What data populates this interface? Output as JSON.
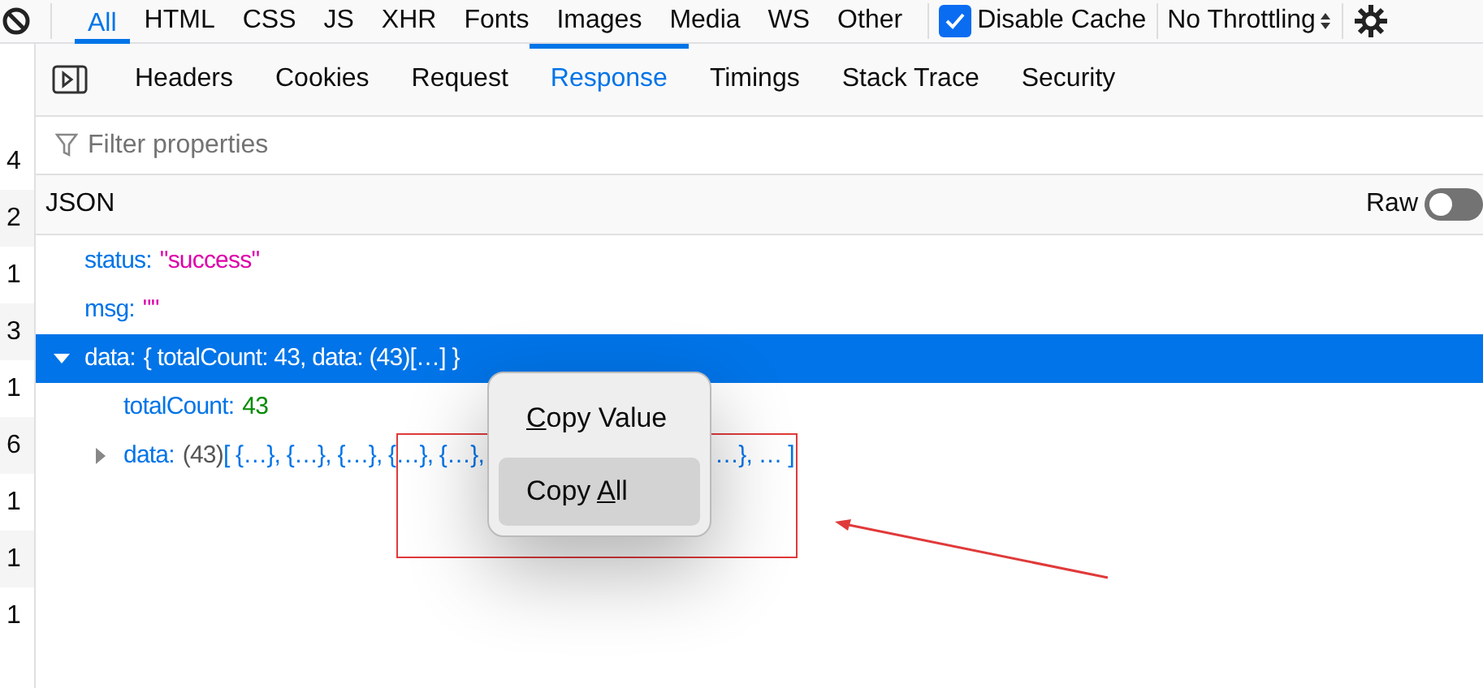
{
  "toolbar": {
    "filters": [
      {
        "label": "All",
        "selected": true
      },
      {
        "label": "HTML",
        "selected": false
      },
      {
        "label": "CSS",
        "selected": false
      },
      {
        "label": "JS",
        "selected": false
      },
      {
        "label": "XHR",
        "selected": false
      },
      {
        "label": "Fonts",
        "selected": false
      },
      {
        "label": "Images",
        "selected": false
      },
      {
        "label": "Media",
        "selected": false
      },
      {
        "label": "WS",
        "selected": false
      },
      {
        "label": "Other",
        "selected": false
      }
    ],
    "disable_cache": {
      "label": "Disable Cache",
      "checked": true
    },
    "throttling": "No Throttling"
  },
  "gutter": [
    "4",
    "2",
    "1",
    "3",
    "1",
    "6",
    "1",
    "1",
    "1"
  ],
  "tabs": [
    {
      "label": "Headers",
      "selected": false
    },
    {
      "label": "Cookies",
      "selected": false
    },
    {
      "label": "Request",
      "selected": false
    },
    {
      "label": "Response",
      "selected": true
    },
    {
      "label": "Timings",
      "selected": false
    },
    {
      "label": "Stack Trace",
      "selected": false
    },
    {
      "label": "Security",
      "selected": false
    }
  ],
  "filter": {
    "placeholder": "Filter properties"
  },
  "json_header": {
    "title": "JSON",
    "raw": {
      "label": "Raw",
      "on": false
    }
  },
  "tree": [
    {
      "key": "status:",
      "value": "\"success\"",
      "kind": "string",
      "selected": false
    },
    {
      "key": "msg:",
      "value": "\"\"",
      "kind": "string",
      "selected": false
    },
    {
      "key": "data:",
      "value": "{ totalCount: 43, data: (43)[…] }",
      "kind": "object",
      "expanded": true,
      "selected": true,
      "children": [
        {
          "key": "totalCount:",
          "value": "43",
          "kind": "number",
          "selected": false
        },
        {
          "key": "data:",
          "count": "(43)",
          "value": "[ {…}, {…}, {…}, {…}, {…},",
          "value_tail": "…}, … ]",
          "kind": "array",
          "expanded": false,
          "selected": false
        }
      ]
    }
  ],
  "context_menu": [
    {
      "key": "C",
      "after": "opy Value",
      "selected": false
    },
    {
      "before": "Copy ",
      "key": "A",
      "after": "ll",
      "selected": true
    }
  ]
}
